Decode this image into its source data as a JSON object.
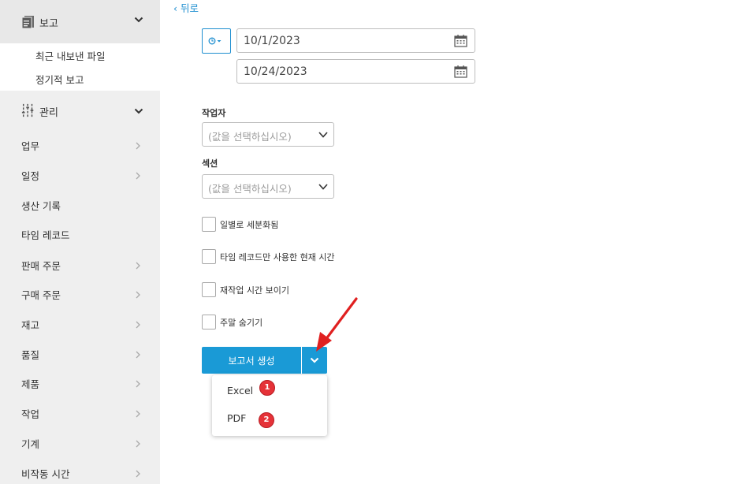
{
  "sidebar": {
    "report_section": {
      "label": "보고",
      "icon": "report-icon"
    },
    "report_sub": [
      "최근 내보낸 파일",
      "정기적 보고"
    ],
    "manage_section": {
      "label": "관리",
      "icon": "sliders-icon"
    },
    "items": [
      "업무",
      "일정",
      "생산 기록",
      "타임 레코드",
      "판매 주문",
      "구매 주문",
      "재고",
      "품질",
      "제품",
      "작업",
      "기계",
      "비작동 시간"
    ]
  },
  "main": {
    "back_label": "‹ 뒤로",
    "date_from": "10/1/2023",
    "date_to": "10/24/2023",
    "author_label": "작업자",
    "author_placeholder": "(값을 선택하십시오)",
    "section_label": "섹션",
    "section_placeholder": "(값을 선택하십시오)",
    "checkboxes": [
      "일별로 세분화됨",
      "타임 레코드만 사용한 현재 시간",
      "재작업 시간 보이기",
      "주말 숨기기"
    ],
    "generate_label": "보고서 생성",
    "menu_items": [
      "Excel",
      "PDF"
    ],
    "badges": [
      "1",
      "2"
    ]
  },
  "colors": {
    "accent": "#1a9ad6",
    "badge": "#e53238",
    "arrow": "#e02020"
  }
}
